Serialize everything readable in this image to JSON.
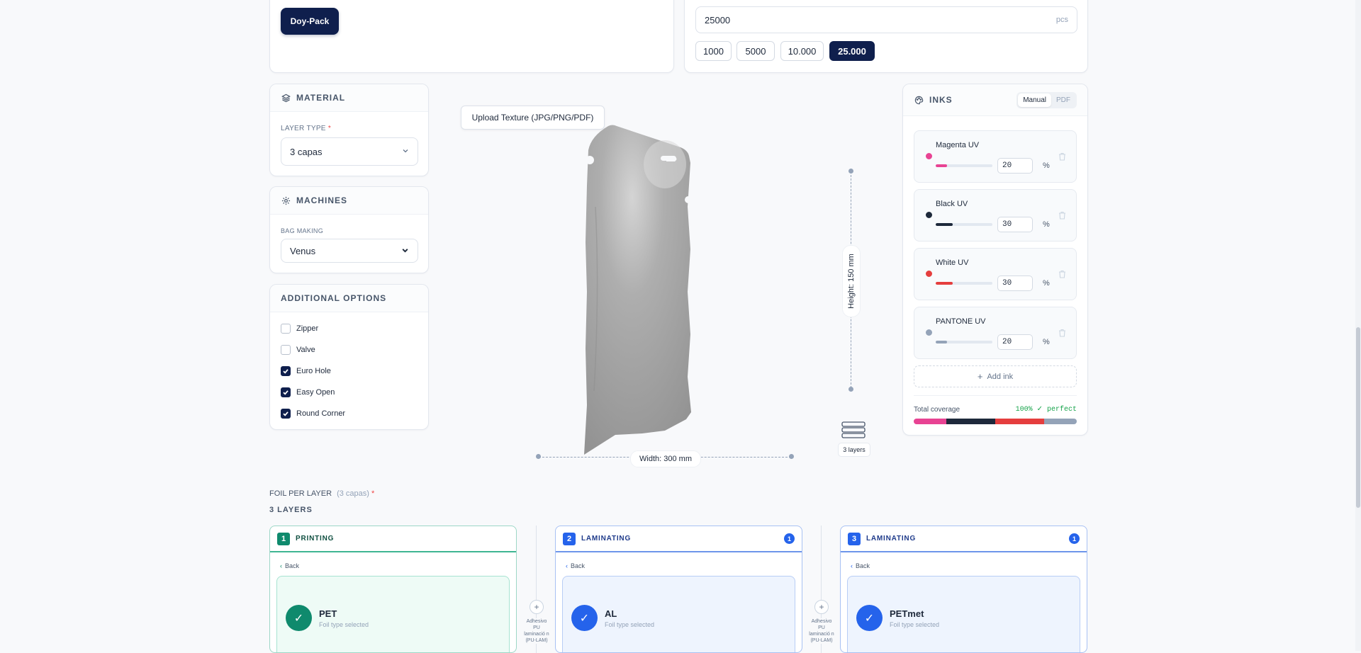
{
  "bag_type": {
    "selected_label": "Doy-Pack"
  },
  "quantity": {
    "value": "25000",
    "unit": "pcs",
    "presets": [
      "1000",
      "5000",
      "10.000",
      "25.000"
    ],
    "selected_preset": "25.000"
  },
  "material": {
    "title": "MATERIAL",
    "layer_type_label": "LAYER TYPE",
    "required_mark": "*",
    "layer_type_value": "3 capas"
  },
  "machines": {
    "title": "MACHINES",
    "bag_making_label": "BAG MAKING",
    "bag_making_value": "Venus"
  },
  "additional_options": {
    "title": "ADDITIONAL OPTIONS",
    "items": [
      {
        "label": "Zipper",
        "checked": false
      },
      {
        "label": "Valve",
        "checked": false
      },
      {
        "label": "Euro Hole",
        "checked": true
      },
      {
        "label": "Easy Open",
        "checked": true
      },
      {
        "label": "Round Corner",
        "checked": true
      }
    ]
  },
  "preview": {
    "upload_label": "Upload Texture (JPG/PNG/PDF)",
    "width_label": "Width: 300 mm",
    "height_label": "Height: 150 mm",
    "layers_label": "3 layers"
  },
  "inks": {
    "title": "INKS",
    "modes": [
      "Manual",
      "PDF"
    ],
    "active_mode": "Manual",
    "items": [
      {
        "name": "Magenta UV",
        "value": "20",
        "unit": "%",
        "color": "#e84393"
      },
      {
        "name": "Black UV",
        "value": "30",
        "unit": "%",
        "color": "#1e293b"
      },
      {
        "name": "White UV",
        "value": "30",
        "unit": "%",
        "color": "#e53e3e"
      },
      {
        "name": "PANTONE UV",
        "value": "20",
        "unit": "%",
        "color": "#94a3b8"
      }
    ],
    "add_label": "Add ink",
    "coverage_label": "Total coverage",
    "coverage_value": "100% ✓ perfect"
  },
  "foil": {
    "title": "FOIL PER LAYER",
    "subtitle": "(3 capas)",
    "required_mark": "*",
    "layers_count_label": "3 LAYERS",
    "layers": [
      {
        "num": "1",
        "title": "PRINTING",
        "badge": "",
        "back_label": "Back",
        "foil": "PET",
        "status": "Foil type selected",
        "accent": "#0f8a6d"
      },
      {
        "num": "2",
        "title": "LAMINATING",
        "badge": "1",
        "back_label": "Back",
        "foil": "AL",
        "status": "Foil type selected",
        "accent": "#2563eb"
      },
      {
        "num": "3",
        "title": "LAMINATING",
        "badge": "1",
        "back_label": "Back",
        "foil": "PETmet",
        "status": "Foil type selected",
        "accent": "#2563eb"
      }
    ],
    "connectors": [
      {
        "label": "Adhesivo PU laminació n (PU-LAM)"
      },
      {
        "label": "Adhesivo PU laminació n (PU-LAM)"
      }
    ]
  }
}
